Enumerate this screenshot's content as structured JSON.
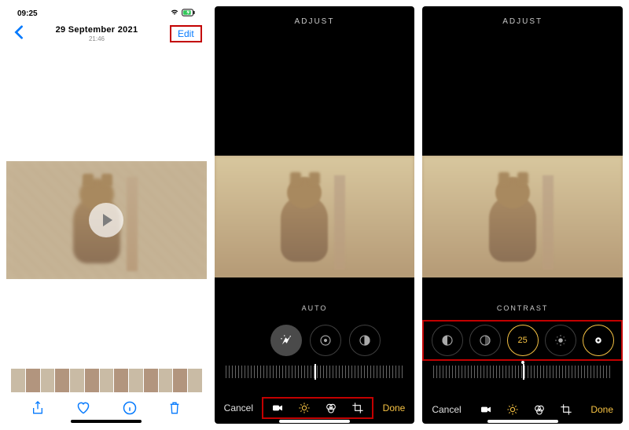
{
  "screen1": {
    "status": {
      "time": "09:25"
    },
    "header": {
      "date": "29 September 2021",
      "time": "21:46",
      "edit": "Edit"
    }
  },
  "screen2": {
    "title": "ADJUST",
    "label": "AUTO",
    "cancel": "Cancel",
    "done": "Done"
  },
  "screen3": {
    "title": "ADJUST",
    "label": "CONTRAST",
    "value": "25",
    "cancel": "Cancel",
    "done": "Done"
  }
}
